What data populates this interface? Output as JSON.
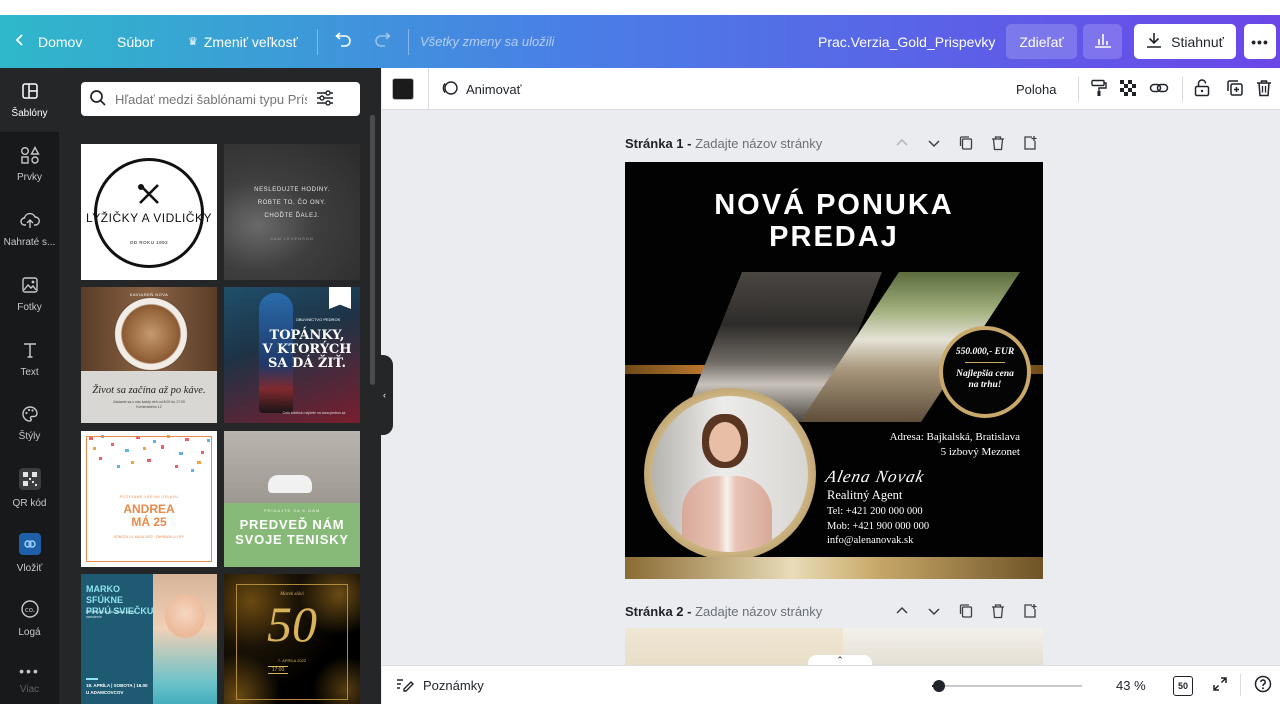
{
  "topbar": {
    "home": "Domov",
    "file": "Súbor",
    "resize": "Zmeniť veľkosť",
    "save_status": "Všetky zmeny sa uložili",
    "design_title": "Prac.Verzia_Gold_Prispevky",
    "share": "Zdieľať",
    "download": "Stiahnuť",
    "more": "•••"
  },
  "rail": {
    "items": [
      {
        "label": "Šablóny",
        "icon": "templates-icon"
      },
      {
        "label": "Prvky",
        "icon": "elements-icon"
      },
      {
        "label": "Nahraté s...",
        "icon": "upload-icon"
      },
      {
        "label": "Fotky",
        "icon": "photos-icon"
      },
      {
        "label": "Text",
        "icon": "text-icon"
      },
      {
        "label": "Štýly",
        "icon": "styles-icon"
      },
      {
        "label": "QR kód",
        "icon": "qr-icon"
      },
      {
        "label": "Vložiť",
        "icon": "embed-icon"
      },
      {
        "label": "Logá",
        "icon": "logos-icon"
      },
      {
        "label": "Viac",
        "icon": "more-icon"
      }
    ]
  },
  "panel": {
    "search_placeholder": "Hľadať medzi šablónami typu Prísp",
    "templates": {
      "t1": {
        "title": "LYŽIČKY A VIDLIČKY",
        "sub": "OD ROKU 1992"
      },
      "t2": {
        "line1": "NESLEDUJTE HODINY.",
        "line2": "ROBTE TO, ČO ONY.",
        "line3": "CHOĎTE ĎALEJ.",
        "author": "SAM LEVENSON"
      },
      "t3": {
        "cafe": "KAVIAREŇ NOVA",
        "quote": "Život sa začína až po káve.",
        "small": "Zastavte sa u nás každý deň od 8:00 do 17:00 Komenského 12"
      },
      "t4": {
        "shop": "OBUVNÍCTVO PEDROS",
        "line1": "TOPÁNKY,",
        "line2": "V KTORÝCH",
        "line3": "SA DÁ ŽIŤ.",
        "web": "Celú kolekciu nájdete na www.pedros.sk"
      },
      "t5": {
        "top": "POZÝVAME VÁS NA OSLAVU",
        "name": "ANDREA",
        "age": "MÁ 25",
        "bottom": "SOBOTA 14. MÁJA 2022 · ZÁHRADA U LIPY"
      },
      "t6": {
        "small": "PRIDAJTE SA K NÁM",
        "line1": "PREDVEĎ NÁM",
        "line2": "SVOJE TENISKY"
      },
      "t7": {
        "line1": "MARKO SFÚKNE",
        "line2": "PRVÚ SVIEČKU",
        "small": "Nenechajte si ujsť oslavu prvých narodenín",
        "date": "18. APRÍLA | SOBOTA | 16.00",
        "place": "U ADAMCOVCOV"
      },
      "t8": {
        "top": "Marek slávi",
        "num": "50",
        "date": "7. APRÍLA 2022",
        "time": "17:00"
      }
    }
  },
  "context_toolbar": {
    "color": "#1b1b1b",
    "animate": "Animovať",
    "position": "Poloha"
  },
  "pages": [
    {
      "label": "Stránka 1 -",
      "title_placeholder": "Zadajte názov stránky"
    },
    {
      "label": "Stránka 2 -",
      "title_placeholder": "Zadajte názov stránky"
    }
  ],
  "design": {
    "headline1": "NOVÁ PONUKA",
    "headline2": "PREDAJ",
    "price": "550.000,- EUR",
    "best1": "Najlepšia cena",
    "best2": "na trhu!",
    "address1": "Adresa: Bajkalská, Bratislava",
    "address2": "5 izbový Mezonet",
    "signature": "Alena Novak",
    "role": "Realitný Agent",
    "tel": "Tel: +421 200 000 000",
    "mob": "Mob: +421 900 000 000",
    "email": "info@alenanovak.sk",
    "gold": "#c9a96a",
    "orange": "#e8913b"
  },
  "bottombar": {
    "notes": "Poznámky",
    "zoom": "43 %",
    "page_count": "50",
    "zoom_level_fraction": 0.0
  }
}
